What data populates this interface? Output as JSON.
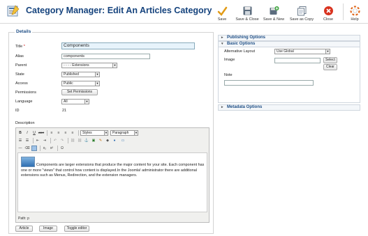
{
  "header": {
    "title": "Category Manager: Edit An Articles Category"
  },
  "toolbar": {
    "save": "Save",
    "save_close": "Save & Close",
    "save_new": "Save & New",
    "save_copy": "Save as Copy",
    "close": "Close",
    "help": "Help"
  },
  "details": {
    "legend": "Details",
    "title_label": "Title",
    "title_required": "*",
    "title_value": "Components",
    "alias_label": "Alias",
    "alias_value": "components",
    "parent_label": "Parent",
    "parent_value": "- - - - Extensions",
    "state_label": "State",
    "state_value": "Published",
    "access_label": "Access",
    "access_value": "Public",
    "permissions_label": "Permissions",
    "permissions_button": "Set Permissions",
    "language_label": "Language",
    "language_value": "All",
    "id_label": "ID",
    "id_value": "21",
    "description_label": "Description"
  },
  "editor": {
    "styles": "Styles",
    "paragraph": "Paragraph",
    "content": "Components are larger extensions that produce the major content for your site. Each component has one or more \"views\" that control how content is displayed.In the Joomla! administrator there are additional extensions such as Menus, Redirection, and the extension managers.",
    "path": "Path: p",
    "btn_article": "Article",
    "btn_image": "Image",
    "btn_toggle": "Toggle editor"
  },
  "sidebar": {
    "publishing": "Publishing Options",
    "basic": "Basic Options",
    "alt_layout_label": "Alternative Layout",
    "alt_layout_value": "Use Global",
    "image_label": "Image",
    "select_btn": "Select",
    "clear_btn": "Clear",
    "note_label": "Note",
    "metadata": "Metadata Options"
  }
}
